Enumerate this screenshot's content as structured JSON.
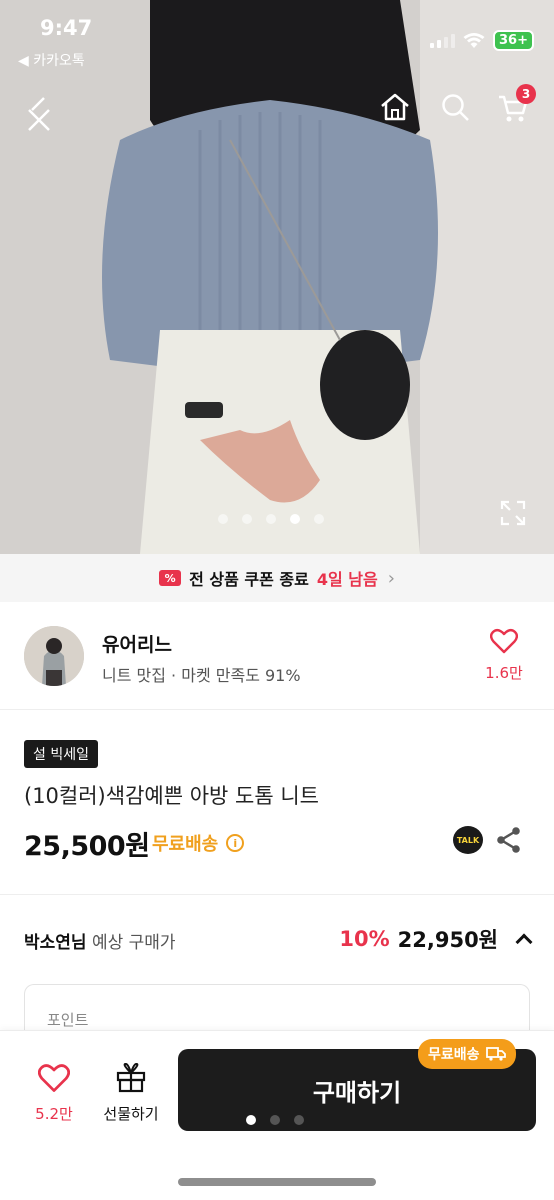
{
  "status": {
    "time": "9:47",
    "back_app": "◀ 카카오톡",
    "battery": "36+"
  },
  "header": {
    "cart_count": "3"
  },
  "coupon": {
    "icon_text": "%",
    "text": "전 상품 쿠폰 종료",
    "days": "4일 남음",
    "chevron": "›"
  },
  "shop": {
    "name": "유어리느",
    "meta": "니트 맛집 · 마켓 만족도 91%",
    "likes": "1.6만"
  },
  "product": {
    "badge": "설 빅세일",
    "title": "(10컬러)색감예쁜 아방 도톰 니트",
    "price": "25,500원",
    "free_shipping": "무료배송",
    "info_icon": "i",
    "talk": "TALK"
  },
  "expected": {
    "buyer": "박소연님",
    "label": "예상 구매가",
    "discount": "10%",
    "price": "22,950원"
  },
  "point": {
    "label": "포인트"
  },
  "bottom": {
    "likes": "5.2만",
    "gift_label": "선물하기",
    "buy_label": "구매하기",
    "ship_tag": "무료배송"
  },
  "colors": {
    "accent": "#e8334c",
    "shipping": "#f0a01e",
    "buy_button": "#1c1c1c"
  }
}
